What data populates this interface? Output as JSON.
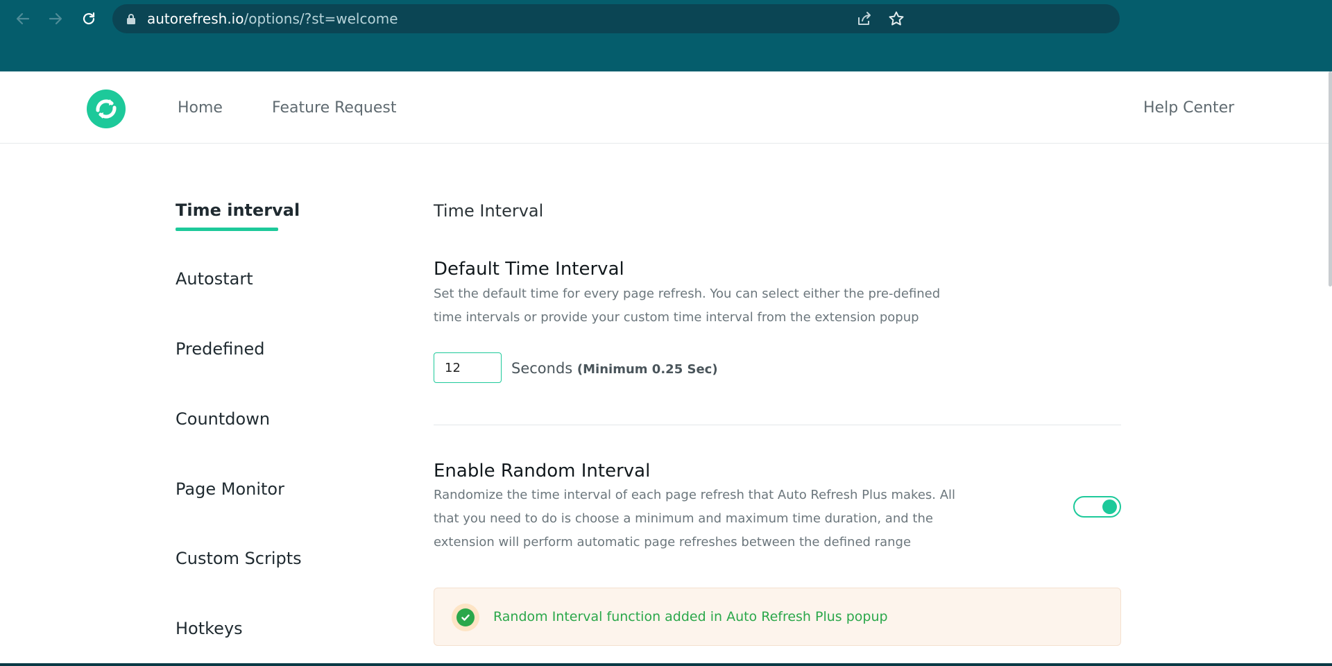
{
  "browser": {
    "url_host": "autorefresh.io",
    "url_path": "/options/?st=welcome",
    "icons": [
      "back-arrow-icon",
      "forward-arrow-icon",
      "reload-icon",
      "lock-icon",
      "share-icon",
      "star-icon"
    ]
  },
  "header": {
    "nav": {
      "home": "Home",
      "feature_request": "Feature Request",
      "help_center": "Help Center"
    },
    "logo_icon": "refresh-logo-icon"
  },
  "sidebar": {
    "items": [
      {
        "label": "Time interval",
        "active": true
      },
      {
        "label": "Autostart"
      },
      {
        "label": "Predefined"
      },
      {
        "label": "Countdown"
      },
      {
        "label": "Page Monitor"
      },
      {
        "label": "Custom Scripts"
      },
      {
        "label": "Hotkeys"
      }
    ]
  },
  "main": {
    "section_title": "Time Interval",
    "default_interval": {
      "heading": "Default Time Interval",
      "description": "Set the default time for every page refresh. You can select either the pre-defined time intervals or provide your custom time interval from the extension popup",
      "value": "12",
      "unit": "Seconds",
      "minimum_note": "(Minimum 0.25 Sec)"
    },
    "random_interval": {
      "heading": "Enable Random Interval",
      "description": "Randomize the time interval of each page refresh that Auto Refresh Plus makes. All that you need to do is choose a minimum and maximum time duration, and the extension will perform automatic page refreshes between the defined range",
      "enabled": true
    },
    "notice": {
      "text": "Random Interval function added in Auto Refresh Plus popup",
      "icon": "check-circle-icon"
    }
  },
  "colors": {
    "chrome": "#055d6c",
    "omnibox": "#0b4554",
    "accent": "#1dc99a",
    "success": "#2aa74a",
    "notice_bg": "#fdf4ec"
  }
}
